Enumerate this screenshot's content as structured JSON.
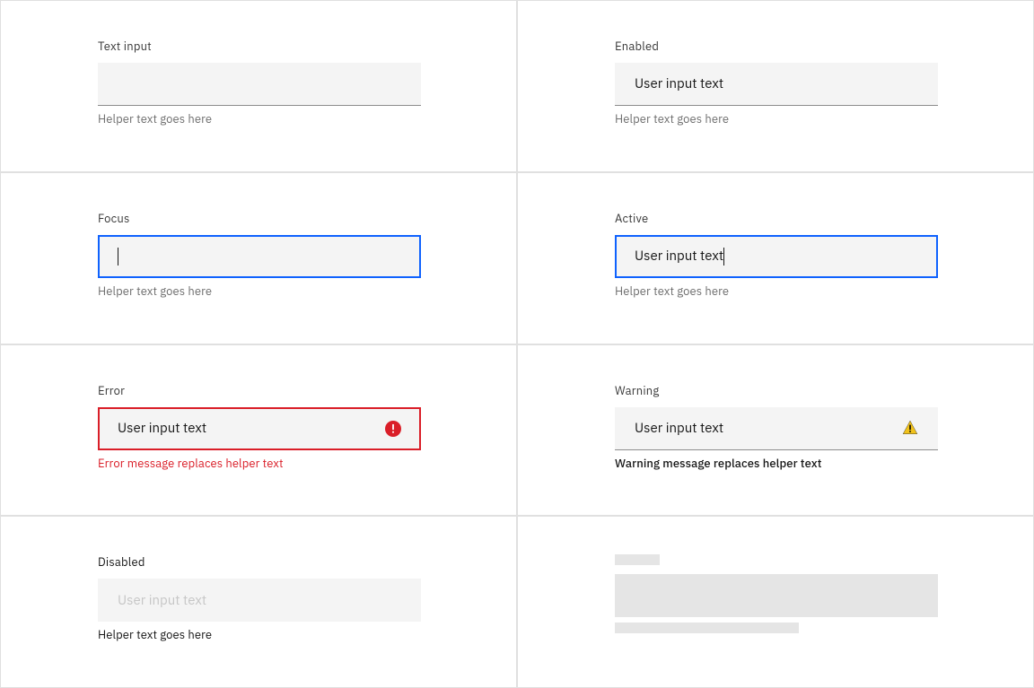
{
  "states": {
    "default": {
      "label": "Text input",
      "value": "",
      "helper": "Helper text goes here"
    },
    "enabled": {
      "label": "Enabled",
      "value": "User input text",
      "helper": "Helper text goes here"
    },
    "focus": {
      "label": "Focus",
      "value": "",
      "helper": "Helper text goes here"
    },
    "active": {
      "label": "Active",
      "value": "User input text",
      "helper": "Helper text goes here"
    },
    "error": {
      "label": "Error",
      "value": "User input text",
      "helper": "Error message replaces helper text"
    },
    "warning": {
      "label": "Warning",
      "value": "User input text",
      "helper": "Warning message replaces helper text"
    },
    "disabled": {
      "label": "Disabled",
      "value": "User input text",
      "helper": "Helper text goes here"
    }
  },
  "colors": {
    "focus_border": "#0f62fe",
    "error": "#da1e28",
    "warning_icon": "#f1c21b",
    "field_bg": "#f4f4f4",
    "skeleton": "#e5e5e5"
  }
}
